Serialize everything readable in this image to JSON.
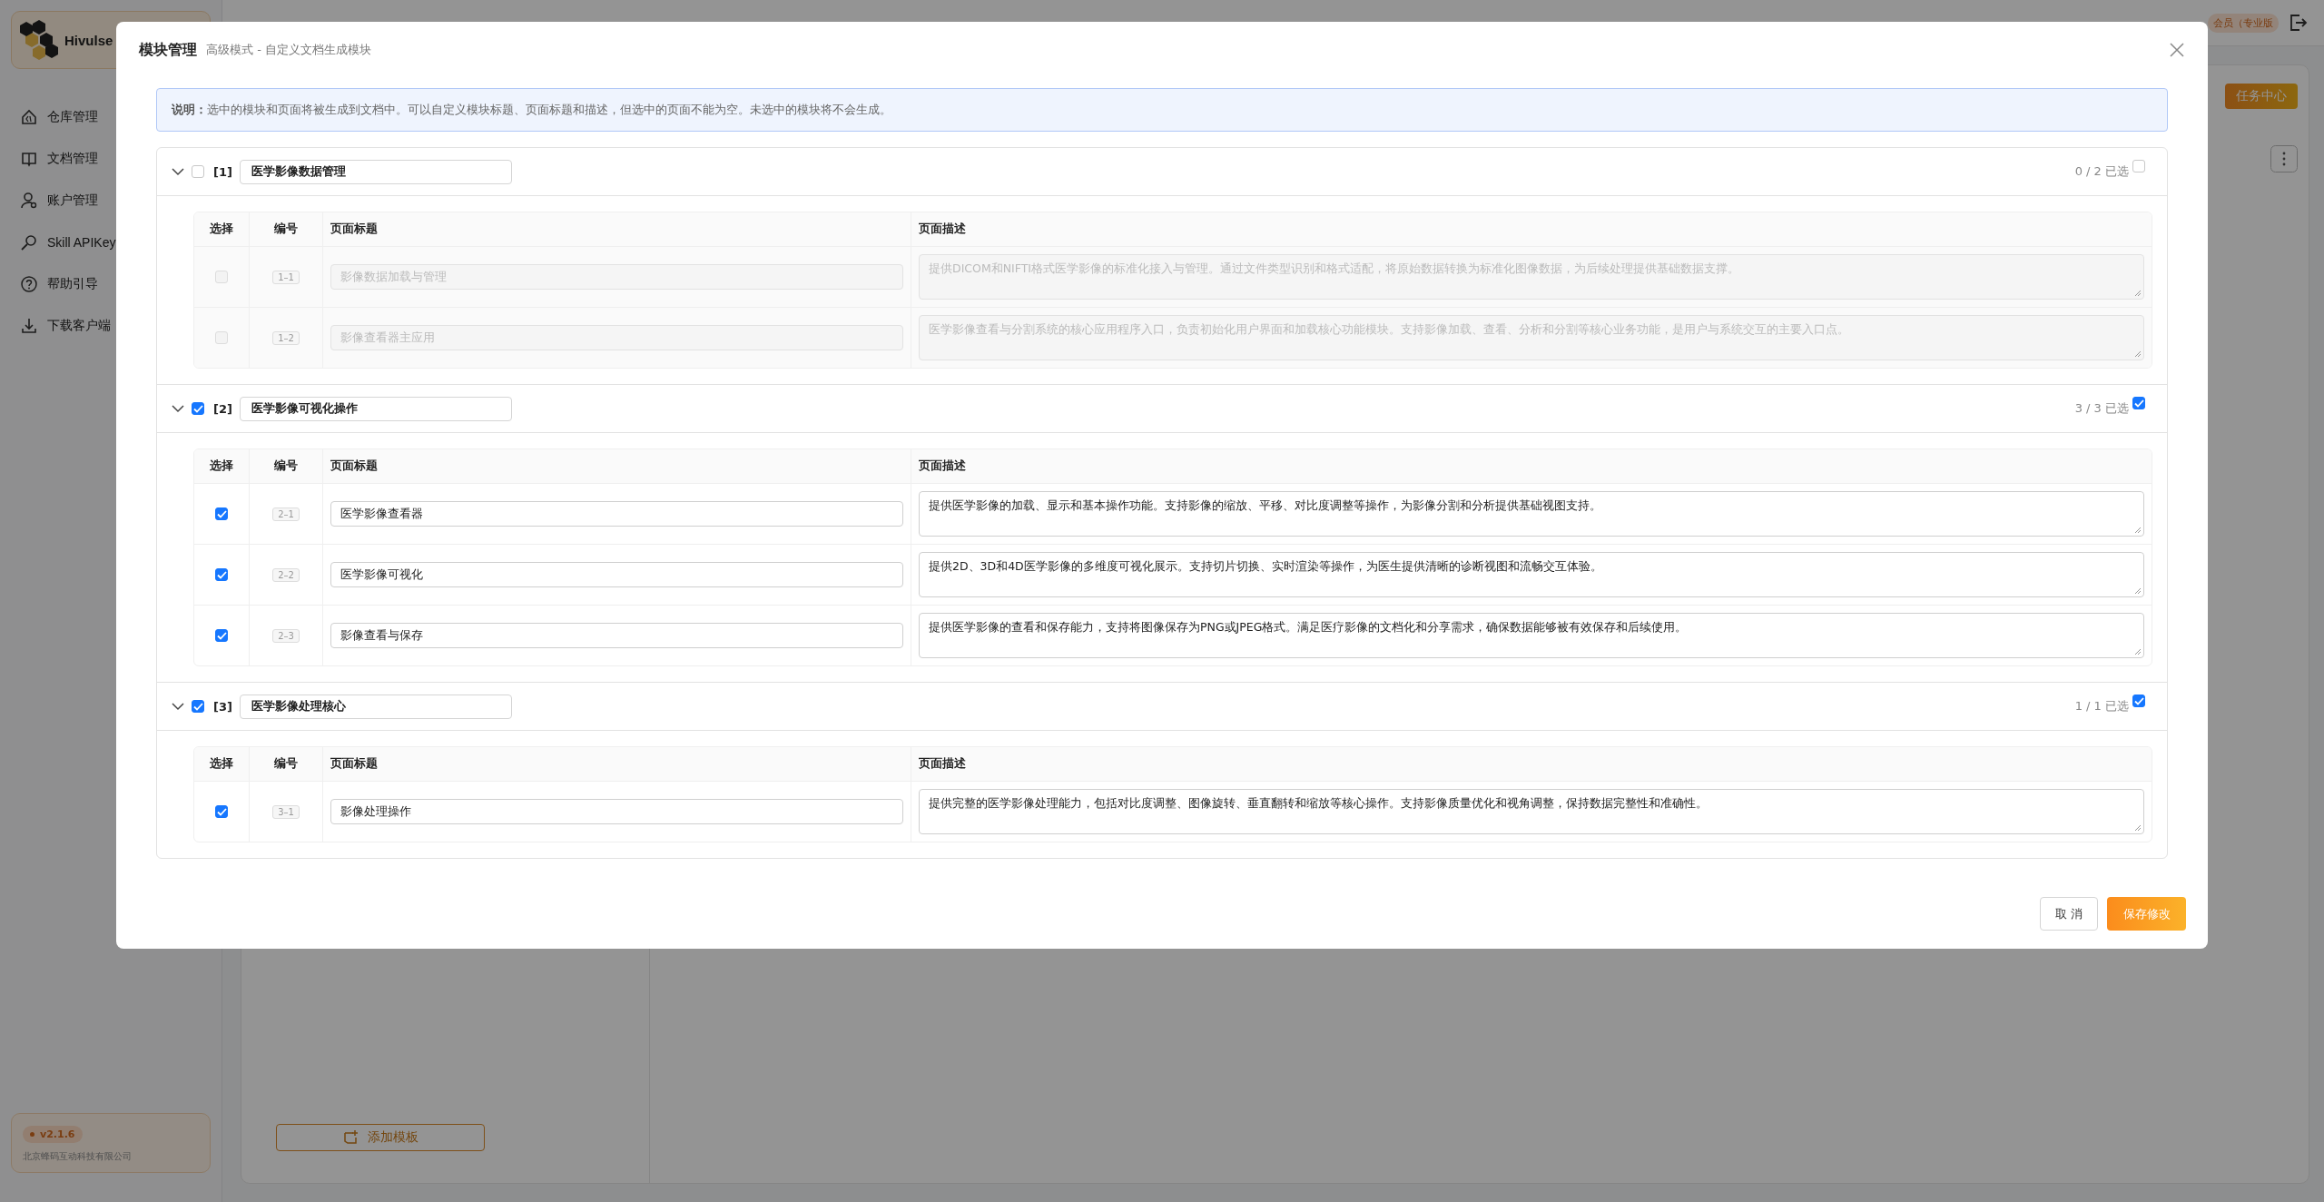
{
  "sidebar": {
    "brand": "Hivulse",
    "items": [
      {
        "label": "仓库管理"
      },
      {
        "label": "文档管理"
      },
      {
        "label": "账户管理"
      },
      {
        "label": "Skill APIKey"
      },
      {
        "label": "帮助引导"
      },
      {
        "label": "下载客户端"
      }
    ],
    "version": "v2.1.6",
    "company": "北京蜂码互动科技有限公司"
  },
  "header": {
    "membership": "会员（专业版"
  },
  "toolbar": {
    "task_center": "任务中心"
  },
  "templates": {
    "add_button": "添加模板"
  },
  "dialog": {
    "title": "模块管理",
    "subtitle": "高级模式 - 自定义文档生成模块",
    "notice": "**说明：**选中的模块和页面将被生成到文档中。可以自定义模块标题、页面标题和描述，但选中的页面不能为空。未选中的模块将不会生成。",
    "modules": [
      {
        "index": "[1]",
        "title": "医学影像数据管理",
        "checked": false,
        "expanded": true,
        "count": "0 / 2 已选",
        "select_all": false,
        "columns": [
          "选择",
          "编号",
          "页面标题",
          "页面描述"
        ],
        "pages": [
          {
            "code": "1–1",
            "checked": false,
            "title": "影像数据加载与管理",
            "description": "提供DICOM和NIFTI格式医学影像的标准化接入与管理。通过文件类型识别和格式适配，将原始数据转换为标准化图像数据，为后续处理提供基础数据支撑。"
          },
          {
            "code": "1–2",
            "checked": false,
            "title": "影像查看器主应用",
            "description": "医学影像查看与分割系统的核心应用程序入口，负责初始化用户界面和加载核心功能模块。支持影像加载、查看、分析和分割等核心业务功能，是用户与系统交互的主要入口点。"
          }
        ]
      },
      {
        "index": "[2]",
        "title": "医学影像可视化操作",
        "checked": true,
        "expanded": true,
        "count": "3 / 3 已选",
        "select_all": true,
        "columns": [
          "选择",
          "编号",
          "页面标题",
          "页面描述"
        ],
        "pages": [
          {
            "code": "2–1",
            "checked": true,
            "title": "医学影像查看器",
            "description": "提供医学影像的加载、显示和基本操作功能。支持影像的缩放、平移、对比度调整等操作，为影像分割和分析提供基础视图支持。"
          },
          {
            "code": "2–2",
            "checked": true,
            "title": "医学影像可视化",
            "description": "提供2D、3D和4D医学影像的多维度可视化展示。支持切片切换、实时渲染等操作，为医生提供清晰的诊断视图和流畅交互体验。"
          },
          {
            "code": "2–3",
            "checked": true,
            "title": "影像查看与保存",
            "description": "提供医学影像的查看和保存能力，支持将图像保存为PNG或JPEG格式。满足医疗影像的文档化和分享需求，确保数据能够被有效保存和后续使用。"
          }
        ]
      },
      {
        "index": "[3]",
        "title": "医学影像处理核心",
        "checked": true,
        "expanded": true,
        "count": "1 / 1 已选",
        "select_all": true,
        "columns": [
          "选择",
          "编号",
          "页面标题",
          "页面描述"
        ],
        "pages": [
          {
            "code": "3–1",
            "checked": true,
            "title": "影像处理操作",
            "description": "提供完整的医学影像处理能力，包括对比度调整、图像旋转、垂直翻转和缩放等核心操作。支持影像质量优化和视角调整，保持数据完整性和准确性。"
          }
        ]
      }
    ],
    "buttons": {
      "cancel": "取 消",
      "save": "保存修改"
    }
  }
}
